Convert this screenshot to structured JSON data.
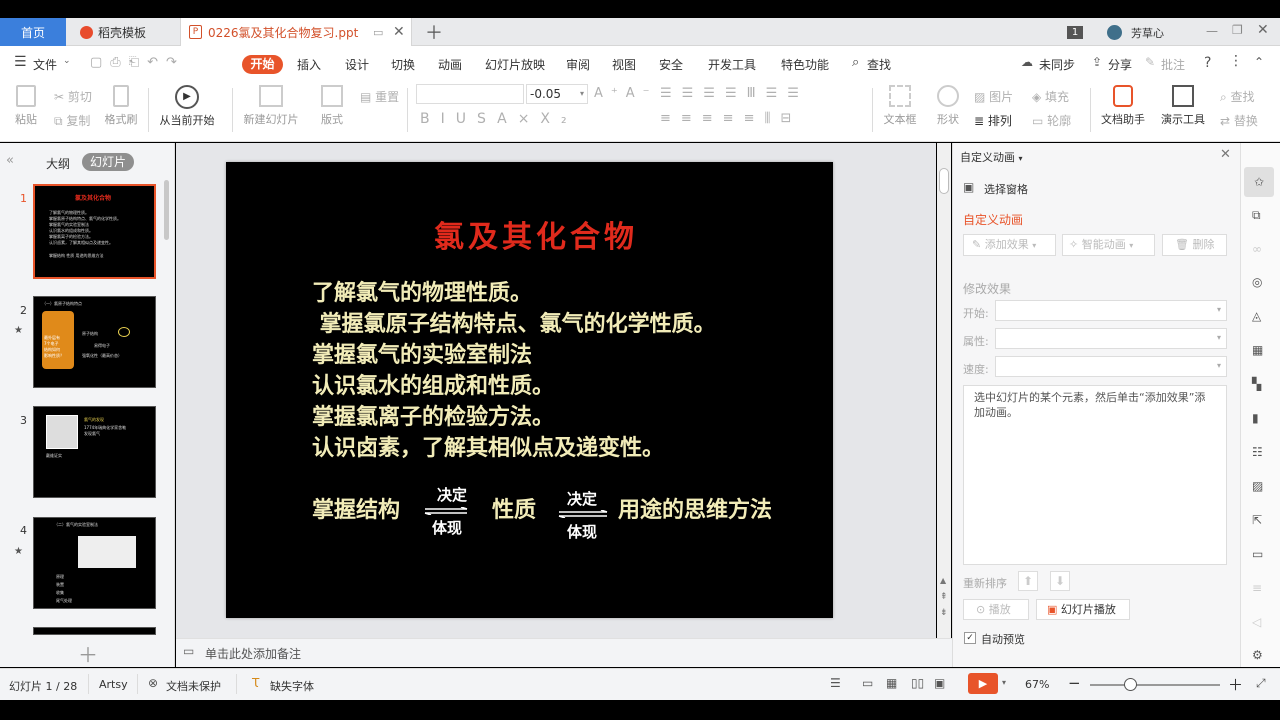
{
  "tabs": {
    "home": "首页",
    "template": "稻壳模板",
    "doc": "0226氯及其化合物复习.ppt"
  },
  "titlebar": {
    "badge": "1",
    "user": "芳草心"
  },
  "menu": {
    "file": "文件",
    "items": [
      "开始",
      "插入",
      "设计",
      "切换",
      "动画",
      "幻灯片放映",
      "审阅",
      "视图",
      "安全",
      "开发工具",
      "特色功能"
    ],
    "search": "查找",
    "sync": "未同步",
    "share": "分享",
    "comment": "批注"
  },
  "ribbon": {
    "paste": "粘贴",
    "cut": "剪切",
    "copy": "复制",
    "format_painter": "格式刷",
    "from_current": "从当前开始",
    "new_slide": "新建幻灯片",
    "layout": "版式",
    "reset": "重置",
    "font_size": "-0.05",
    "textbox": "文本框",
    "shape": "形状",
    "arrange": "排列",
    "image": "图片",
    "fill": "填充",
    "outline": "轮廓",
    "doc_assistant": "文档助手",
    "presentation_tools": "演示工具",
    "find": "查找",
    "replace": "替换"
  },
  "left_panel": {
    "outline": "大纲",
    "slides": "幻灯片"
  },
  "thumbnails": [
    {
      "num": "1",
      "title": "氯及其化合物",
      "lines": [
        "了解氯气的物理性质。",
        "掌握氯原子结构特点、氯气的化学性质。",
        "掌握氯气的实验室制法",
        "认识氯水的组成和性质。",
        "掌握氯离子的检验方法。",
        "认识卤素，了解其相似点及递变性。"
      ],
      "bottom": "掌握结构   性质   用途的思维方法"
    },
    {
      "num": "2",
      "title": "（一）氯原子结构特点",
      "lines": [
        "最外层有",
        "7个电子",
        "结构如何",
        "影响性质？",
        "原子结构",
        "易得电子",
        "强氧化性（最高价态）"
      ]
    },
    {
      "num": "3",
      "title": "",
      "lines": [
        "氯气的发现",
        "1774年瑞典化学家舍勒",
        "发现氯气",
        "戴维证实"
      ]
    },
    {
      "num": "4",
      "title": "（二）氯气的实验室制法",
      "lines": [
        "原理",
        "装置",
        "收集",
        "尾气处理"
      ]
    }
  ],
  "slide": {
    "title": "氯及其化合物",
    "lines": [
      "了解氯气的物理性质。",
      " 掌握氯原子结构特点、氯气的化学性质。",
      "掌握氯气的实验室制法",
      "认识氯水的组成和性质。",
      "掌握氯离子的检验方法。",
      "认识卤素，了解其相似点及递变性。"
    ],
    "bottom": {
      "part1": "掌握结构",
      "arrow1_top": "决定",
      "arrow1_bottom": "体现",
      "part2": "性质",
      "arrow2_top": "决定",
      "arrow2_bottom": "体现",
      "part3": "用途的思维方法"
    }
  },
  "notes": {
    "placeholder": "单击此处添加备注"
  },
  "right_panel": {
    "header": "自定义动画",
    "select_pane": "选择窗格",
    "section_title": "自定义动画",
    "add_effect": "添加效果",
    "smart_anim": "智能动画",
    "delete": "删除",
    "modify": "修改效果",
    "start_label": "开始:",
    "property_label": "属性:",
    "speed_label": "速度:",
    "hint": "选中幻灯片的某个元素，然后单击“添加效果”添加动画。",
    "reorder": "重新排序",
    "play": "播放",
    "slideshow": "幻灯片播放",
    "auto_preview": "自动预览"
  },
  "status": {
    "slide_info": "幻灯片 1 / 28",
    "theme": "Artsy",
    "protect": "文档未保护",
    "missing_font": "缺失字体",
    "zoom": "67%"
  },
  "colors": {
    "accent": "#e8542a",
    "slide_title": "#e02a1c",
    "slide_text": "#f2ecb8",
    "tab_blue": "#3b7fdc"
  }
}
